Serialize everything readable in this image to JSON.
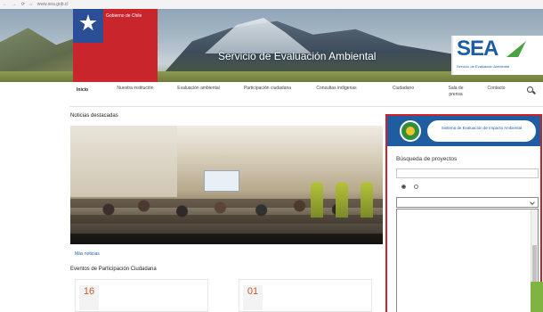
{
  "browser": {
    "address": [
      "←",
      "→",
      "⟳",
      "⌂",
      "www.sea.gob.cl"
    ]
  },
  "header": {
    "gov_label": "Gobierno de Chile",
    "gov_footer": "",
    "site_title": "Servicio de Evaluación Ambiental",
    "sea_mark": "SEA",
    "sea_sub": "Servicio de Evaluación Ambiental"
  },
  "nav": {
    "home": "Inicio",
    "items": [
      "Nuestra institución",
      "Evaluación ambiental",
      "Participación ciudadana",
      "Consultas indígenas",
      "Ciudadano",
      "Sala de prensa",
      "Contacto"
    ]
  },
  "main": {
    "news_section": "Noticias destacadas",
    "news_caption": "",
    "more_news": "Más noticias",
    "events_section": "Eventos de Participación Ciudadana",
    "cards": [
      {
        "day": "16",
        "month": "",
        "title": "",
        "sub": ""
      },
      {
        "day": "01",
        "month": "",
        "title": "",
        "sub": ""
      }
    ]
  },
  "widget": {
    "header_text": "Sistema de Evaluación de Impacto Ambiental",
    "title": "Búsqueda de proyectos",
    "input_placeholder": "",
    "radio_a": "",
    "radio_b": "",
    "select_value": "",
    "options": [
      "",
      "",
      "",
      "",
      "",
      "",
      "",
      "",
      "",
      "",
      "",
      ""
    ],
    "selected_index": 5
  },
  "colors": {
    "accent_blue": "#1f5da2",
    "widget_border": "#d0202a",
    "selected_option": "#2f6fcf",
    "gov_red": "#c8252c"
  }
}
